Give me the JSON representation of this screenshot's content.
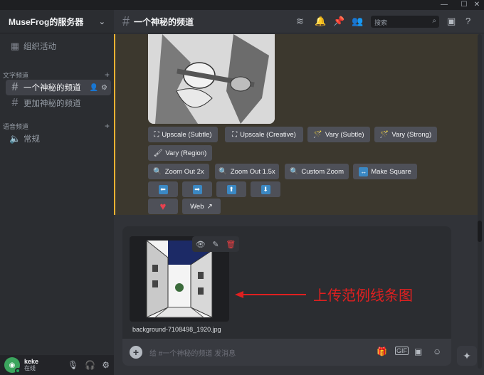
{
  "window": {
    "minimize": "—",
    "maximize": "☐",
    "close": "✕"
  },
  "server": {
    "name": "MuseFrog的服务器"
  },
  "sidebar": {
    "events_label": "组织活动",
    "text_category": "文字频道",
    "text_channels": [
      {
        "label": "一个神秘的频道",
        "active": true
      },
      {
        "label": "更加神秘的频道",
        "active": false
      }
    ],
    "voice_category": "语音频道",
    "voice_channels": [
      {
        "label": "常规"
      }
    ]
  },
  "user": {
    "name": "keke",
    "status": "在线"
  },
  "channel": {
    "title": "一个神秘的频道",
    "search_placeholder": "搜索"
  },
  "buttons": {
    "row1": [
      {
        "label": "Upscale (Subtle)",
        "icon": "⛶"
      },
      {
        "label": "Upscale (Creative)",
        "icon": "⛶"
      },
      {
        "label": "Vary (Subtle)",
        "icon": "🪄"
      },
      {
        "label": "Vary (Strong)",
        "icon": "🪄"
      }
    ],
    "row2": [
      {
        "label": "Vary (Region)",
        "icon": "🖌"
      }
    ],
    "row3": [
      {
        "label": "Zoom Out 2x",
        "icon": "🔍"
      },
      {
        "label": "Zoom Out 1.5x",
        "icon": "🔍"
      },
      {
        "label": "Custom Zoom",
        "icon": "🔍"
      },
      {
        "label": "Make Square",
        "icon": "↔"
      }
    ],
    "row4": [
      "⬅",
      "➡",
      "⬆",
      "⬇"
    ],
    "heart": "♥",
    "web": "Web"
  },
  "upload": {
    "filename": "background-7108498_1920.jpg",
    "annotation": "上传范例线条图"
  },
  "composer": {
    "placeholder": "给 #一个神秘的频道 发消息"
  },
  "colors": {
    "accent": "#f0b232",
    "annotation": "#e02020"
  }
}
